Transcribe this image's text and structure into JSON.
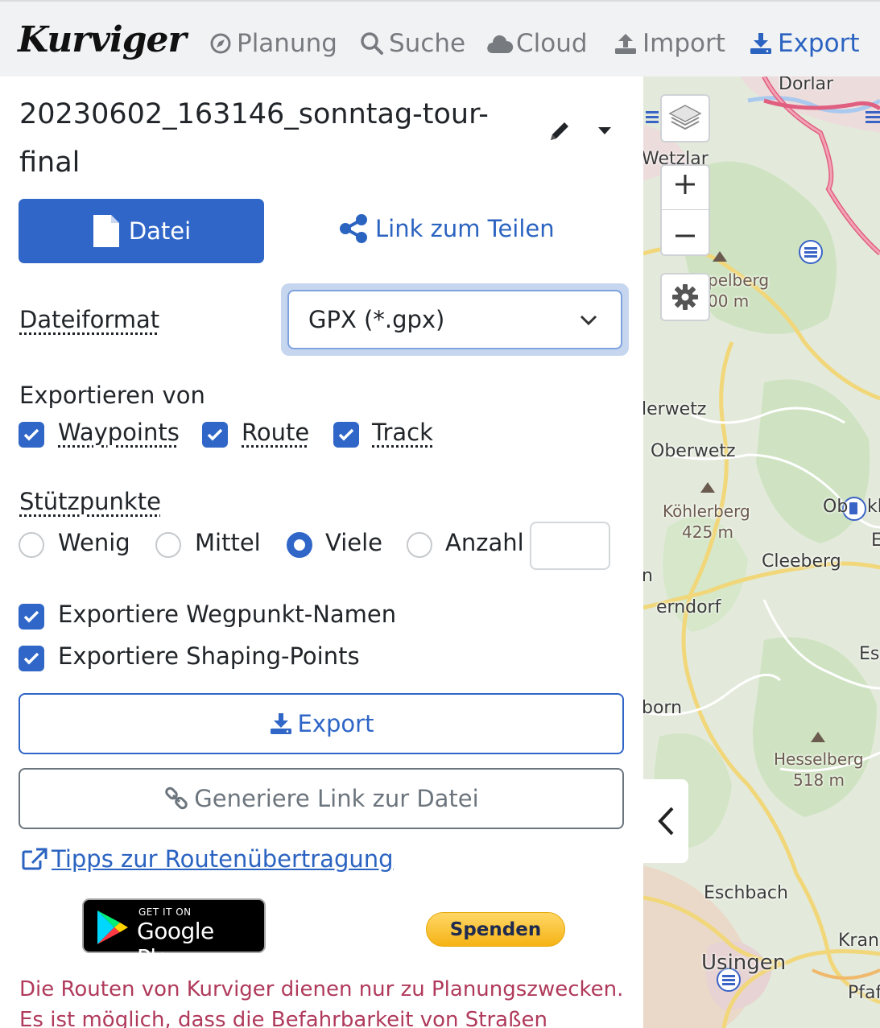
{
  "navbar": {
    "logo": "Kurviger",
    "items": [
      {
        "label": "Planung",
        "icon": "compass-icon"
      },
      {
        "label": "Suche",
        "icon": "search-icon"
      },
      {
        "label": "Cloud",
        "icon": "cloud-icon"
      },
      {
        "label": "Import",
        "icon": "upload-icon"
      },
      {
        "label": "Export",
        "icon": "download-icon",
        "active": true
      }
    ]
  },
  "panel": {
    "title": "20230602_163146_sonntag-tour-final",
    "datei_button": "Datei",
    "share_link": "Link zum Teilen",
    "format_label": "Dateiformat",
    "format_value": "GPX (*.gpx)",
    "export_from_label": "Exportieren von",
    "export_from": [
      {
        "label": "Waypoints",
        "checked": true
      },
      {
        "label": "Route",
        "checked": true
      },
      {
        "label": "Track",
        "checked": true
      }
    ],
    "stuetzpunkte_label": "Stützpunkte",
    "stuetzpunkte": [
      {
        "label": "Wenig",
        "selected": false
      },
      {
        "label": "Mittel",
        "selected": false
      },
      {
        "label": "Viele",
        "selected": true
      },
      {
        "label": "Anzahl",
        "selected": false
      }
    ],
    "anzahl_value": "",
    "options": [
      {
        "label": "Exportiere Wegpunkt-Namen",
        "checked": true
      },
      {
        "label": "Exportiere Shaping-Points",
        "checked": true
      }
    ],
    "export_button": "Export",
    "generate_link_button": "Generiere Link zur Datei",
    "tips_link": "Tipps zur Routenübertragung",
    "gplay_small": "GET IT ON",
    "gplay_big": "Google Play",
    "donate": "Spenden",
    "disclaimer": "Die Routen von Kurviger dienen nur zu Planungszwecken. Es ist möglich, dass die Befahrbarkeit von Straßen aufgrund von"
  },
  "map": {
    "labels": [
      {
        "text": "Dorlar"
      },
      {
        "text": "Wetzlar"
      },
      {
        "text": "pelberg"
      },
      {
        "text": "00 m"
      },
      {
        "text": "lerwetz"
      },
      {
        "text": "Oberwetz"
      },
      {
        "text": "Köhlerberg"
      },
      {
        "text": "425 m"
      },
      {
        "text": "Ob"
      },
      {
        "text": "kl"
      },
      {
        "text": "E"
      },
      {
        "text": "Cleeberg"
      },
      {
        "text": "n"
      },
      {
        "text": "erndorf"
      },
      {
        "text": "Es"
      },
      {
        "text": "born"
      },
      {
        "text": "Hesselberg"
      },
      {
        "text": "518 m"
      },
      {
        "text": "Eschbach"
      },
      {
        "text": "Kran"
      },
      {
        "text": "Usingen"
      },
      {
        "text": "Pfaf"
      }
    ]
  },
  "colors": {
    "primary": "#2f66c7",
    "link": "#2b63c1",
    "disclaimer": "#b03a5b",
    "navbar_bg": "#f1f2f3"
  }
}
